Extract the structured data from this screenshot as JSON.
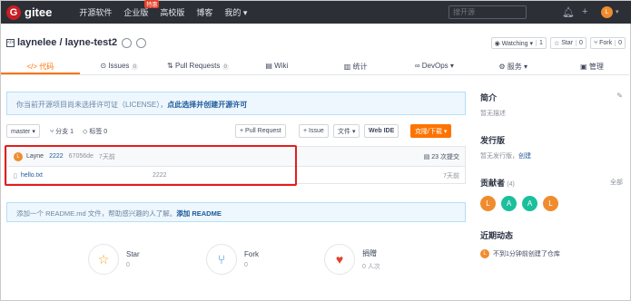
{
  "nav": {
    "logo_letter": "G",
    "logo_text": "gitee",
    "links": [
      {
        "label": "开源软件"
      },
      {
        "label": "企业版",
        "badge": "特惠"
      },
      {
        "label": "高校版"
      },
      {
        "label": "博客"
      },
      {
        "label": "我的 ▾"
      }
    ],
    "search_placeholder": "搜开源",
    "bell_icon": "bell-icon",
    "plus_icon": "plus-icon",
    "avatar_letter": "L"
  },
  "repo": {
    "title": "laynelee / layne-test2",
    "watch_label": "Watching ▾",
    "watch_count": "1",
    "star_label": "Star",
    "star_count": "0",
    "fork_label": "Fork",
    "fork_count": "0"
  },
  "tabs": [
    {
      "label": "</> 代码",
      "active": true
    },
    {
      "label": "Issues",
      "count": "0"
    },
    {
      "label": "Pull Requests",
      "count": "0"
    },
    {
      "label": "Wiki"
    },
    {
      "label": "统计"
    },
    {
      "label": "DevOps ▾"
    },
    {
      "label": "服务 ▾"
    },
    {
      "label": "管理"
    }
  ],
  "license": {
    "text": "你当前开源项目尚未选择许可证（LICENSE），",
    "link": "点此选择并创建开源许可"
  },
  "toolbar": {
    "branch": "master ▾",
    "branches": "分支 1",
    "tags": "标签 0",
    "pull_request": "+ Pull Request",
    "issue": "+ Issue",
    "file": "文件 ▾",
    "webide": "Web IDE",
    "clone": "克隆/下载 ▾"
  },
  "commit": {
    "avatar": "L",
    "author": "Layne",
    "message": "2222",
    "hash": "67056de",
    "time": "7天前",
    "commits": "23 次提交"
  },
  "files": [
    {
      "name": "hello.txt",
      "message": "2222",
      "time": "7天前"
    }
  ],
  "readme": {
    "text": "添加一个 README.md 文件，帮助感兴趣的人了解。",
    "link": "添加 README"
  },
  "stats": [
    {
      "label": "Star",
      "value": "0",
      "icon": "star-icon"
    },
    {
      "label": "Fork",
      "value": "0",
      "icon": "fork-icon"
    },
    {
      "label": "捐赠",
      "value": "0 人次",
      "icon": "donate-icon"
    }
  ],
  "sidebar": {
    "intro_title": "简介",
    "intro_text": "暂无描述",
    "release_title": "发行版",
    "release_text": "暂无发行版，",
    "release_link": "创建",
    "contrib_title": "贡献者",
    "contrib_count": "(4)",
    "contrib_all": "全部",
    "contributors": [
      {
        "letter": "L",
        "color": "#f08c2e"
      },
      {
        "letter": "A",
        "color": "#1cbf9b"
      },
      {
        "letter": "A",
        "color": "#1cbf9b"
      },
      {
        "letter": "L",
        "color": "#f08c2e"
      }
    ],
    "activity_title": "近期动态",
    "activity_avatar": "L",
    "activity_text": "不到1分钟前创建了仓库"
  },
  "colors": {
    "accent": "#fe7300",
    "brand": "#c71d23",
    "highlight": "#e31d1d"
  }
}
